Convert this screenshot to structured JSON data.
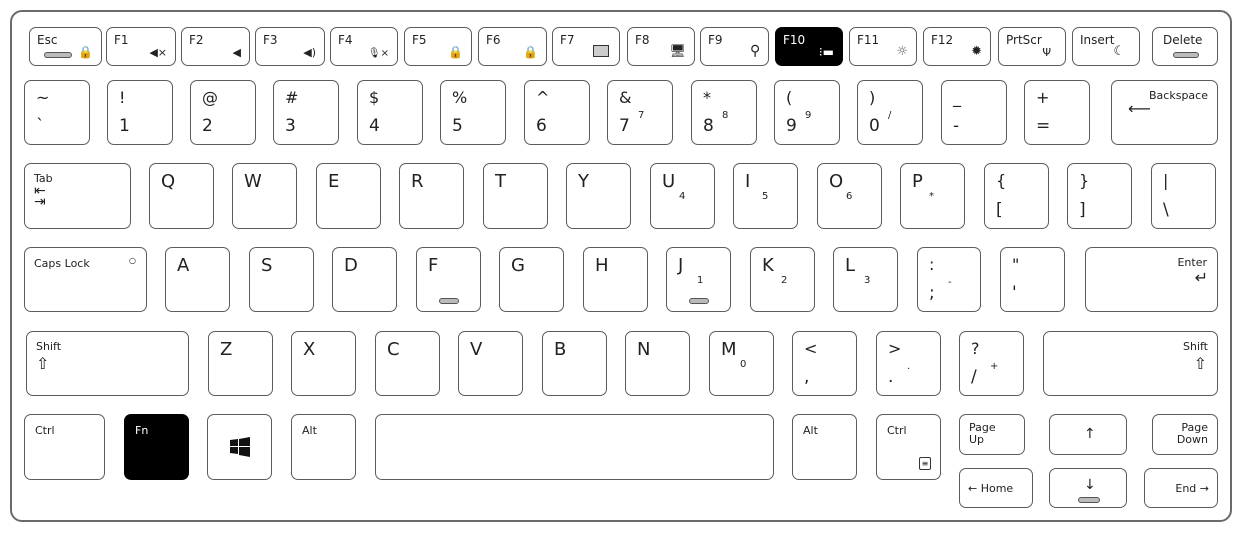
{
  "keyboard": {
    "fn_row": {
      "esc": {
        "label": "Esc",
        "icon": "lock-icon"
      },
      "f1": {
        "label": "F1",
        "icon": "mute-icon",
        "glyph": "◀×"
      },
      "f2": {
        "label": "F2",
        "icon": "volume-down-icon",
        "glyph": "◀"
      },
      "f3": {
        "label": "F3",
        "icon": "volume-up-icon",
        "glyph": "◀)"
      },
      "f4": {
        "label": "F4",
        "icon": "mic-mute-icon",
        "glyph": "🎙×"
      },
      "f5": {
        "label": "F5",
        "icon": "num-lock-icon",
        "glyph": "🔒"
      },
      "f6": {
        "label": "F6",
        "icon": "scroll-lock-icon",
        "glyph": "🔒"
      },
      "f7": {
        "label": "F7",
        "icon": "display-switch-icon",
        "glyph": "▨"
      },
      "f8": {
        "label": "F8",
        "icon": "project-display-icon",
        "glyph": "🖳"
      },
      "f9": {
        "label": "F9",
        "icon": "search-icon",
        "glyph": "⚲"
      },
      "f10": {
        "label": "F10",
        "icon": "keyboard-backlight-icon",
        "glyph": "☼"
      },
      "f11": {
        "label": "F11",
        "icon": "brightness-down-icon",
        "glyph": "☼"
      },
      "f12": {
        "label": "F12",
        "icon": "brightness-up-icon",
        "glyph": "✹"
      },
      "prtscr": {
        "label": "PrtScr",
        "icon": "wireless-icon",
        "glyph": "Ψ"
      },
      "insert": {
        "label": "Insert",
        "icon": "sleep-moon-icon",
        "glyph": "☾"
      },
      "delete": {
        "label": "Delete"
      }
    },
    "number_row": [
      {
        "top": "~",
        "bottom": "`"
      },
      {
        "top": "!",
        "bottom": "1"
      },
      {
        "top": "@",
        "bottom": "2"
      },
      {
        "top": "#",
        "bottom": "3"
      },
      {
        "top": "$",
        "bottom": "4"
      },
      {
        "top": "%",
        "bottom": "5"
      },
      {
        "top": "^",
        "bottom": "6"
      },
      {
        "top": "&",
        "bottom": "7",
        "numpad": "7"
      },
      {
        "top": "*",
        "bottom": "8",
        "numpad": "8"
      },
      {
        "top": "(",
        "bottom": "9",
        "numpad": "9"
      },
      {
        "top": ")",
        "bottom": "0",
        "numpad": "/"
      },
      {
        "top": "_",
        "bottom": "-"
      },
      {
        "top": "+",
        "bottom": "="
      }
    ],
    "backspace": "Backspace",
    "tab": "Tab",
    "qwerty_row": [
      {
        "letter": "Q"
      },
      {
        "letter": "W"
      },
      {
        "letter": "E"
      },
      {
        "letter": "R"
      },
      {
        "letter": "T"
      },
      {
        "letter": "Y"
      },
      {
        "letter": "U",
        "numpad": "4"
      },
      {
        "letter": "I",
        "numpad": "5"
      },
      {
        "letter": "O",
        "numpad": "6"
      },
      {
        "letter": "P",
        "numpad": "*"
      }
    ],
    "bracket_keys": [
      {
        "top": "{",
        "bottom": "["
      },
      {
        "top": "}",
        "bottom": "]"
      },
      {
        "top": "|",
        "bottom": "\\"
      }
    ],
    "caps_lock": "Caps Lock",
    "home_row": [
      {
        "letter": "A"
      },
      {
        "letter": "S"
      },
      {
        "letter": "D"
      },
      {
        "letter": "F"
      },
      {
        "letter": "G"
      },
      {
        "letter": "H"
      },
      {
        "letter": "J",
        "numpad": "1"
      },
      {
        "letter": "K",
        "numpad": "2"
      },
      {
        "letter": "L",
        "numpad": "3"
      }
    ],
    "semicolon": {
      "top": ":",
      "bottom": ";",
      "numpad": "-"
    },
    "quote": {
      "top": "\"",
      "bottom": "'"
    },
    "enter": "Enter",
    "shift_left": "Shift",
    "bottom_letters": [
      {
        "letter": "Z"
      },
      {
        "letter": "X"
      },
      {
        "letter": "C"
      },
      {
        "letter": "V"
      },
      {
        "letter": "B"
      },
      {
        "letter": "N"
      },
      {
        "letter": "M",
        "numpad": "0"
      }
    ],
    "comma": {
      "top": "<",
      "bottom": ","
    },
    "period": {
      "top": ">",
      "bottom": ".",
      "numpad": "."
    },
    "slash": {
      "top": "?",
      "bottom": "/",
      "numpad": "+"
    },
    "shift_right": "Shift",
    "ctrl_left": "Ctrl",
    "fn": "Fn",
    "alt_left": "Alt",
    "alt_right": "Alt",
    "ctrl_right": "Ctrl",
    "page_up": "Page\nUp",
    "page_up_line1": "Page",
    "page_up_line2": "Up",
    "page_down_line1": "Page",
    "page_down_line2": "Down",
    "arrow_up": "↑",
    "arrow_down": "↓",
    "home": "← Home",
    "end": "End →"
  },
  "colors": {
    "highlight": "#000000",
    "outline": "#5c5c5c"
  }
}
